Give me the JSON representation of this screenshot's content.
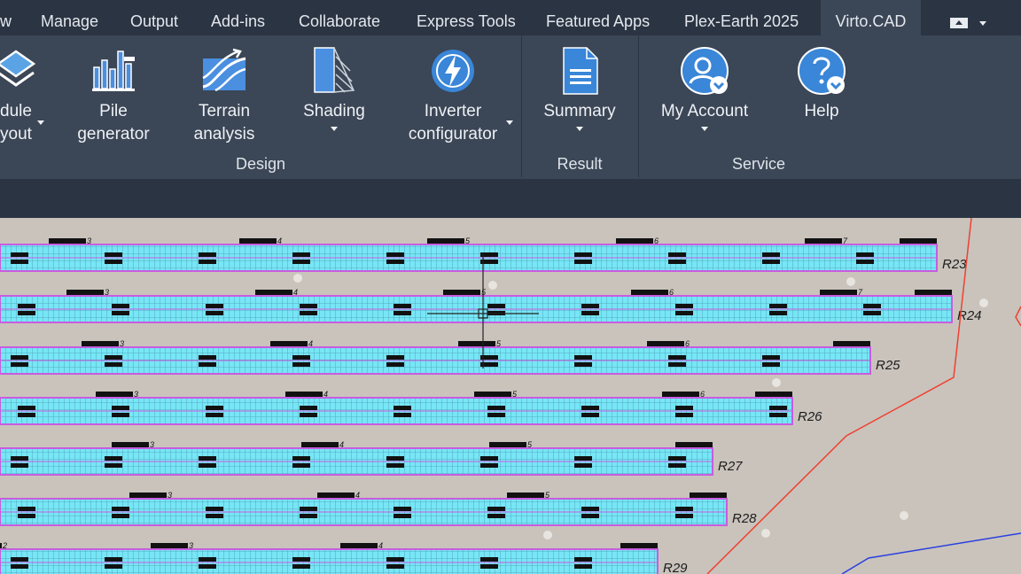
{
  "tabs": [
    {
      "label": "w",
      "active": false
    },
    {
      "label": "Manage",
      "active": false
    },
    {
      "label": "Output",
      "active": false
    },
    {
      "label": "Add-ins",
      "active": false
    },
    {
      "label": "Collaborate",
      "active": false
    },
    {
      "label": "Express Tools",
      "active": false
    },
    {
      "label": "Featured Apps",
      "active": false
    },
    {
      "label": "Plex-Earth 2025",
      "active": false
    },
    {
      "label": "Virto.CAD",
      "active": true
    }
  ],
  "ribbon": {
    "buttons": [
      {
        "line1": "dule",
        "line2": "yout",
        "icon": "module-layout-icon",
        "dropdown": true
      },
      {
        "line1": "Pile",
        "line2": "generator",
        "icon": "pile-generator-icon",
        "dropdown": false
      },
      {
        "line1": "Terrain",
        "line2": "analysis",
        "icon": "terrain-analysis-icon",
        "dropdown": false
      },
      {
        "line1": "Shading",
        "line2": "",
        "icon": "shading-icon",
        "dropdown": true
      },
      {
        "line1": "Inverter",
        "line2": "configurator",
        "icon": "inverter-icon",
        "dropdown": true
      },
      {
        "line1": "Summary",
        "line2": "",
        "icon": "document-icon",
        "dropdown": true
      },
      {
        "line1": "My Account",
        "line2": "",
        "icon": "user-account-icon",
        "dropdown": true
      },
      {
        "line1": "Help",
        "line2": "",
        "icon": "help-icon",
        "dropdown": false
      }
    ],
    "groups": {
      "design": "Design",
      "result": "Result",
      "service": "Service"
    }
  },
  "drawing": {
    "rows": [
      {
        "label": "R23",
        "x_labels": [
          "3",
          "4",
          "5",
          "6",
          "7"
        ]
      },
      {
        "label": "R24",
        "x_labels": [
          "3",
          "4",
          "5",
          "6",
          "7"
        ]
      },
      {
        "label": "R25",
        "x_labels": [
          "3",
          "4",
          "5",
          "6"
        ]
      },
      {
        "label": "R26",
        "x_labels": [
          "3",
          "4",
          "5",
          "6"
        ]
      },
      {
        "label": "R27",
        "x_labels": [
          "3",
          "4",
          "5"
        ]
      },
      {
        "label": "R28",
        "x_labels": [
          "3",
          "4",
          "5"
        ]
      },
      {
        "label": "R29",
        "x_labels": [
          "2",
          "3",
          "4"
        ]
      }
    ],
    "colors": {
      "panel": "#77e6f6",
      "grid": "#c85ce0",
      "boundary": "#f04030",
      "cable": "#2a3fe0",
      "ground": "#c9c3bc"
    }
  }
}
